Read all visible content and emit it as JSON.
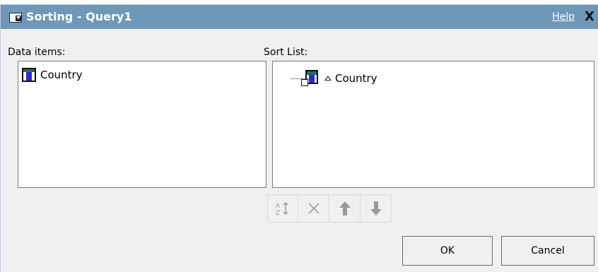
{
  "dialog": {
    "title": "Sorting - Query1",
    "help_label": "Help",
    "close_label": "X"
  },
  "data_items": {
    "label": "Data items:",
    "items": [
      {
        "label": "Country",
        "icon": "column-icon"
      }
    ]
  },
  "sort_list": {
    "label": "Sort List:",
    "items": [
      {
        "label": "Country",
        "direction": "ascending",
        "icon": "sorted-column-icon"
      }
    ]
  },
  "toolbar": {
    "buttons": [
      {
        "name": "sort-order-button",
        "icon": "sort-az-icon",
        "enabled": false
      },
      {
        "name": "delete-button",
        "icon": "delete-x-icon",
        "enabled": false
      },
      {
        "name": "move-up-button",
        "icon": "arrow-up-icon",
        "enabled": false
      },
      {
        "name": "move-down-button",
        "icon": "arrow-down-icon",
        "enabled": false
      }
    ]
  },
  "buttons": {
    "ok_label": "OK",
    "cancel_label": "Cancel"
  },
  "colors": {
    "titlebar": "#6f97b8",
    "dialog_bg": "#f0f0f0",
    "panel_bg": "#ffffff"
  }
}
